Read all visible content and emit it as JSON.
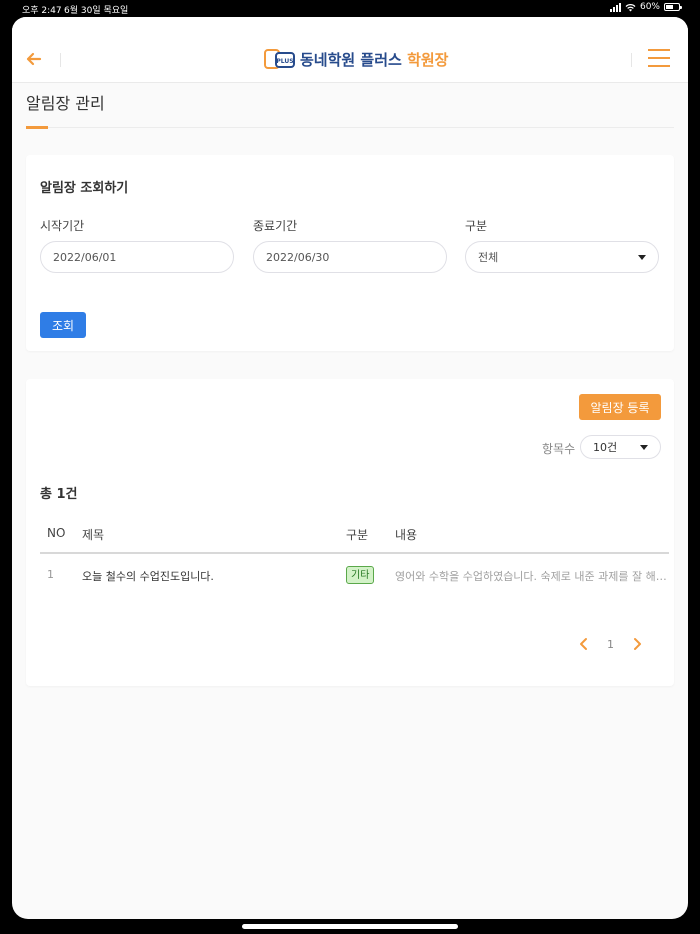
{
  "status_bar": {
    "time": "오후 2:47",
    "date": "6월 30일 목요일",
    "battery": "60%",
    "battery_level": 0.6
  },
  "header": {
    "logo_badge": "PLUS",
    "logo_main": "동네학원 플러스",
    "logo_accent": "학원장"
  },
  "page": {
    "title": "알림장 관리"
  },
  "search": {
    "title": "알림장 조회하기",
    "start_label": "시작기간",
    "start_value": "2022/06/01",
    "end_label": "종료기간",
    "end_value": "2022/06/30",
    "type_label": "구분",
    "type_value": "전체",
    "search_button": "조회"
  },
  "list": {
    "register_button": "알림장 등록",
    "count_label": "항목수",
    "count_value": "10건",
    "total": "총 1건",
    "columns": [
      "NO",
      "제목",
      "구분",
      "내용"
    ],
    "rows": [
      {
        "no": "1",
        "title": "오늘 철수의 수업진도입니다.",
        "type": "기타",
        "content": "영어와 수학을 수업하였습니다. 숙제로 내준 과제를 잘 해오세요."
      }
    ],
    "pagination": {
      "current": "1"
    }
  },
  "colors": {
    "accent": "#f39a3c",
    "primary": "#2f7de6",
    "brand": "#274b8c"
  }
}
